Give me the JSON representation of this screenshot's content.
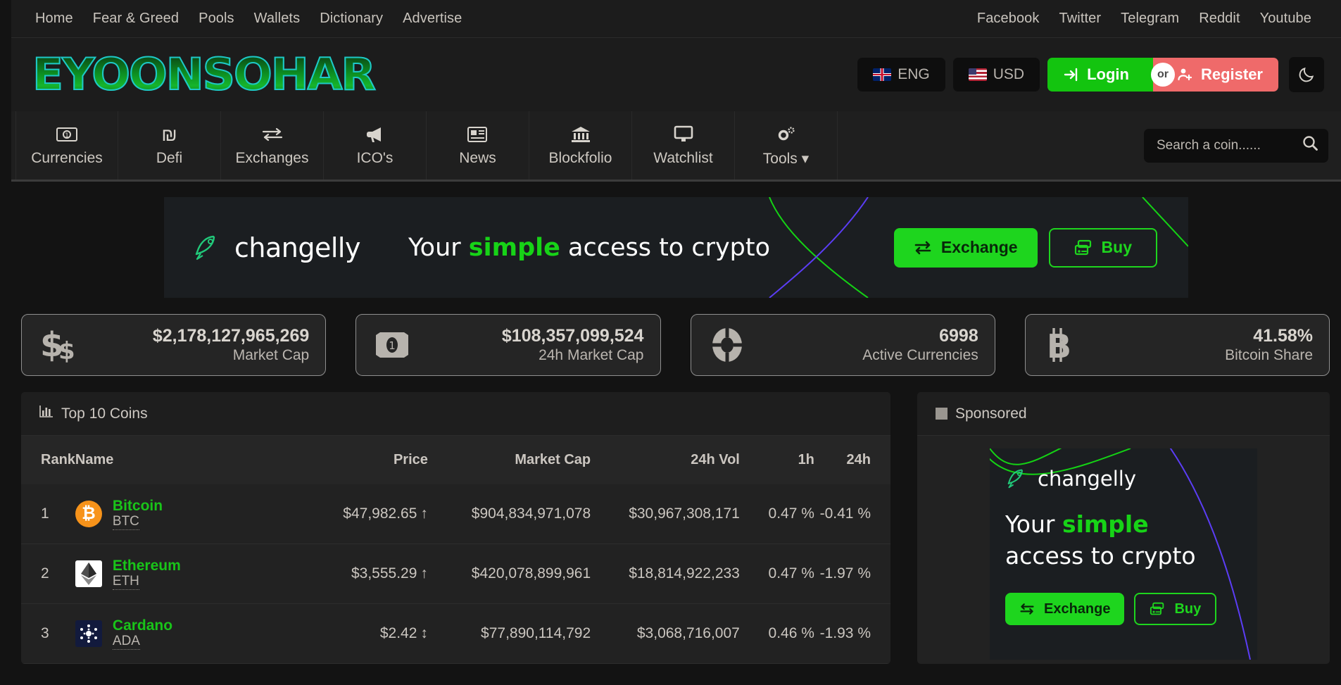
{
  "topbar": {
    "left_links": [
      "Home",
      "Fear & Greed",
      "Pools",
      "Wallets",
      "Dictionary",
      "Advertise"
    ],
    "right_links": [
      "Facebook",
      "Twitter",
      "Telegram",
      "Reddit",
      "Youtube"
    ]
  },
  "header": {
    "logo": "EYOONSOHAR",
    "language": "ENG",
    "currency": "USD",
    "login": "Login",
    "or": "or",
    "register": "Register",
    "dark_mode_icon": "moon-icon"
  },
  "mainnav": {
    "items": [
      {
        "label": "Currencies",
        "icon": "banknote-icon"
      },
      {
        "label": "Defi",
        "icon": "shekel-icon"
      },
      {
        "label": "Exchanges",
        "icon": "exchange-arrows-icon"
      },
      {
        "label": "ICO's",
        "icon": "megaphone-icon"
      },
      {
        "label": "News",
        "icon": "newspaper-icon"
      },
      {
        "label": "Blockfolio",
        "icon": "bank-icon"
      },
      {
        "label": "Watchlist",
        "icon": "monitor-icon"
      },
      {
        "label": "Tools",
        "icon": "gears-icon",
        "caret": "▾"
      }
    ],
    "search": {
      "placeholder": "Search a coin......",
      "value": "",
      "icon": "search-icon"
    }
  },
  "banner": {
    "brand": "changelly",
    "tagline_pre": "Your ",
    "tagline_em": "simple",
    "tagline_post": " access to crypto",
    "exchange_label": "Exchange",
    "buy_label": "Buy",
    "accent": "#1ed51e"
  },
  "stats": [
    {
      "icon": "dollar-signs-icon",
      "value": "$2,178,127,965,269",
      "label": "Market Cap"
    },
    {
      "icon": "banknote-icon",
      "value": "$108,357,099,524",
      "label": "24h Market Cap"
    },
    {
      "icon": "lifebuoy-icon",
      "value": "6998",
      "label": "Active Currencies"
    },
    {
      "icon": "bitcoin-icon",
      "value": "41.58%",
      "label": "Bitcoin Share"
    }
  ],
  "top10": {
    "title": "Top 10 Coins",
    "icon": "bar-chart-icon",
    "columns": [
      "Rank",
      "Name",
      "Price",
      "Market Cap",
      "24h Vol",
      "1h",
      "24h"
    ],
    "rows": [
      {
        "rank": "1",
        "name": "Bitcoin",
        "symbol": "BTC",
        "icon": "bitcoin-coin-icon",
        "price": "$47,982.65",
        "price_trend": "up",
        "price_arrow": "↑",
        "market_cap": "$904,834,971,078",
        "volume_24h": "$30,967,308,171",
        "change_1h": "0.47 %",
        "change_1h_dir": "pos",
        "change_24h": "-0.41 %",
        "change_24h_dir": "neg"
      },
      {
        "rank": "2",
        "name": "Ethereum",
        "symbol": "ETH",
        "icon": "ethereum-coin-icon",
        "price": "$3,555.29",
        "price_trend": "up",
        "price_arrow": "↑",
        "market_cap": "$420,078,899,961",
        "volume_24h": "$18,814,922,233",
        "change_1h": "0.47 %",
        "change_1h_dir": "pos",
        "change_24h": "-1.97 %",
        "change_24h_dir": "neg"
      },
      {
        "rank": "3",
        "name": "Cardano",
        "symbol": "ADA",
        "icon": "cardano-coin-icon",
        "price": "$2.42",
        "price_trend": "flat",
        "price_arrow": "↕",
        "market_cap": "$77,890,114,792",
        "volume_24h": "$3,068,716,007",
        "change_1h": "0.46 %",
        "change_1h_dir": "pos",
        "change_24h": "-1.93 %",
        "change_24h_dir": "neg"
      }
    ]
  },
  "sponsored": {
    "title": "Sponsored",
    "icon": "square-icon",
    "brand": "changelly",
    "tagline_pre": "Your ",
    "tagline_em": "simple",
    "tagline_post": "access to crypto",
    "exchange_label": "Exchange",
    "buy_label": "Buy"
  }
}
